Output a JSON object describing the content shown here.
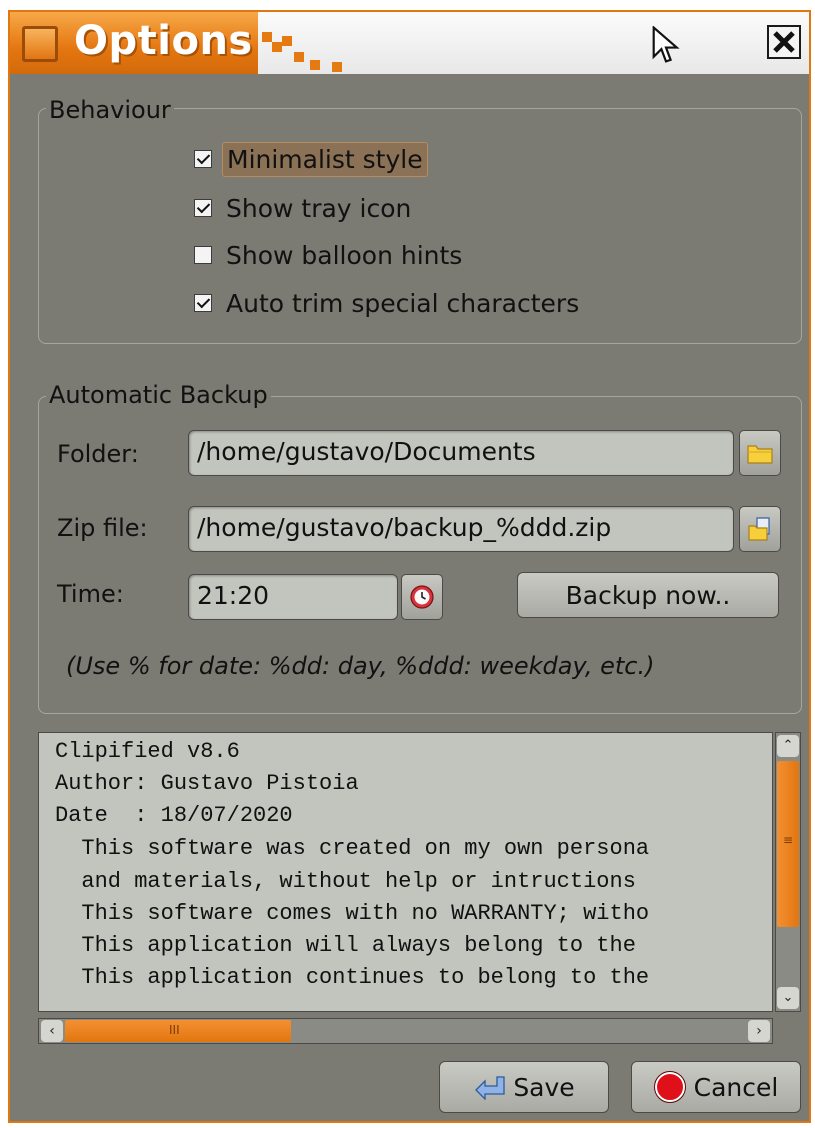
{
  "window": {
    "title": "Options",
    "accent_color": "#e47610",
    "close_icon": "close-icon"
  },
  "behaviour": {
    "legend": "Behaviour",
    "options": [
      {
        "label": "Minimalist style",
        "checked": true,
        "focused": true
      },
      {
        "label": "Show tray icon",
        "checked": true,
        "focused": false
      },
      {
        "label": "Show balloon hints",
        "checked": false,
        "focused": false
      },
      {
        "label": "Auto trim special characters",
        "checked": true,
        "focused": false
      }
    ]
  },
  "backup": {
    "legend": "Automatic Backup",
    "folder_label": "Folder:",
    "folder_value": "/home/gustavo/Documents",
    "zip_label": "Zip file:",
    "zip_value": "/home/gustavo/backup_%ddd.zip",
    "time_label": "Time:",
    "time_value": "21:20",
    "backup_button": "Backup now..",
    "hint": "(Use % for date: %dd: day, %ddd: weekday, etc.)"
  },
  "info": {
    "lines": [
      "Clipified v8.6",
      "Author: Gustavo Pistoia",
      "Date  : 18/07/2020",
      "  This software was created on my own persona",
      "  and materials, without help or intructions",
      "  This software comes with no WARRANTY; witho",
      "  This application will always belong to the",
      "  This application continues to belong to the"
    ]
  },
  "footer": {
    "save_label": "Save",
    "cancel_label": "Cancel"
  }
}
